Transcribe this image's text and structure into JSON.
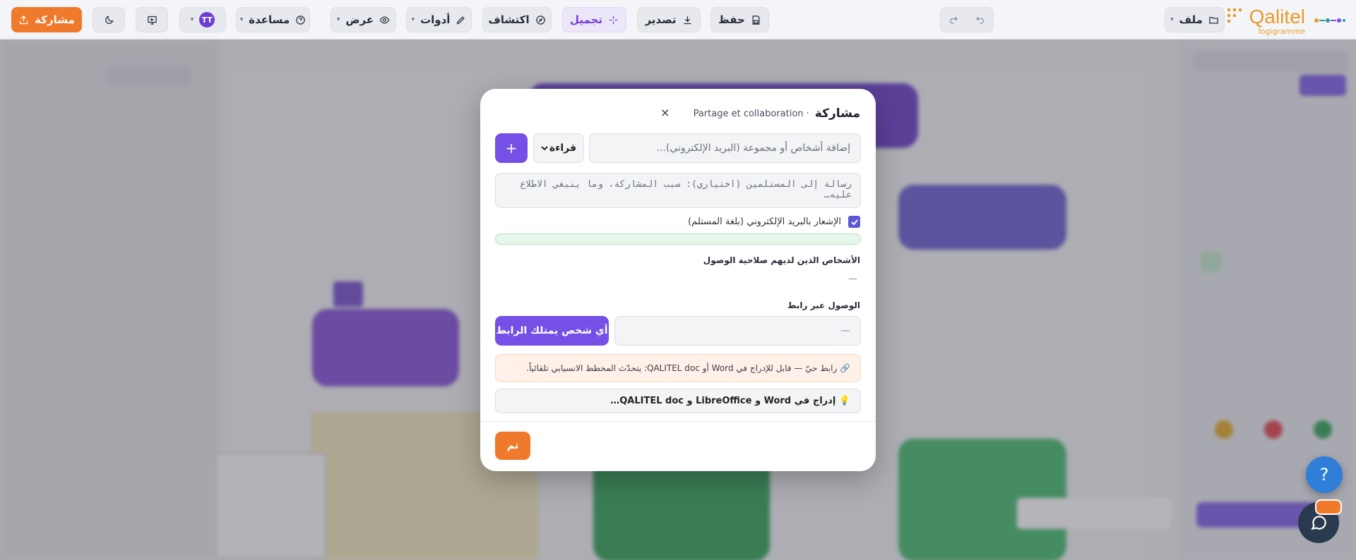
{
  "toolbar": {
    "file_label": "ملف",
    "save_label": "حفظ",
    "export_label": "تصدير",
    "beautify_label": "تجميل",
    "explore_label": "اكتشاف",
    "tools_label": "أدوات",
    "view_label": "عرض",
    "help_label": "مساعدة",
    "user_initials": "TT",
    "share_label": "مشاركة"
  },
  "logo": {
    "brand": "Qalitel",
    "sub": "logigramme"
  },
  "modal": {
    "title": "مشاركة",
    "subtitle": "· Partage et collaboration",
    "close_glyph": "×",
    "invite_placeholder": "إضافة أشخاص أو مجموعة (البريد الإلكتروني)...",
    "permission_value": "قراءة",
    "add_glyph": "+",
    "message_placeholder": "رسالة إلى المستلمين (اختياري): سبب المشاركة، وما ينبغي الاطلاع عليه…",
    "notify_label": "الإشعار بالبريد الإلكتروني (بلغة المستلم)",
    "notify_checked": true,
    "people_heading": "الأشخاص الذين لديهم صلاحية الوصول",
    "people_empty": "—",
    "link_heading": "الوصول عبر رابط",
    "link_value": "—",
    "link_scope_label": "أي شخص يمتلك الرابط",
    "notice_text": "🔗 رابط حيّ — قابل للإدراج في Word أو QALITEL doc: يتحدّث المخطط الانسيابي تلقائياً.",
    "insert_label": "💡 إدراج في Word و LibreOffice و QALITEL doc…",
    "done_label": "تم"
  },
  "floating": {
    "help_glyph": "?"
  },
  "colors": {
    "accent_purple": "#7550e6",
    "accent_orange": "#f07a2b",
    "brand_gold": "#e89a2a"
  }
}
